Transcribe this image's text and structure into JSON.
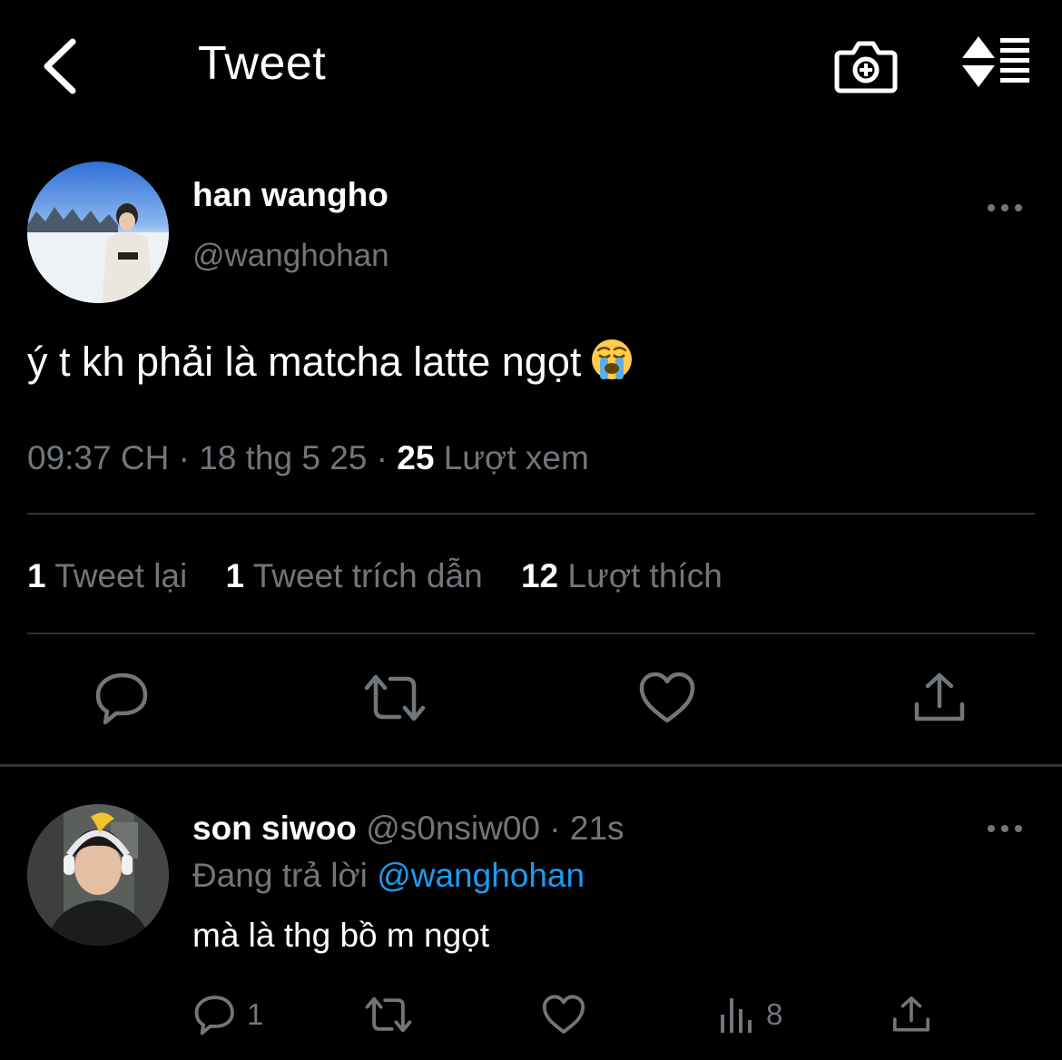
{
  "header": {
    "title": "Tweet"
  },
  "tweet": {
    "author_name": "han wangho",
    "author_handle": "@wanghohan",
    "text": "ý t kh phải là matcha latte ngọt",
    "time": "09:37 CH",
    "date": "18 thg 5 25",
    "views_count": "25",
    "views_label": "Lượt xem",
    "retweets_count": "1",
    "retweets_label": "Tweet lại",
    "quotes_count": "1",
    "quotes_label": "Tweet trích dẫn",
    "likes_count": "12",
    "likes_label": "Lượt thích"
  },
  "reply": {
    "author_name": "son siwoo",
    "author_handle": "@s0nsiw00",
    "time": "21s",
    "replying_prefix": "Đang trả lời",
    "replying_to": "@wanghohan",
    "text": "mà là thg bồ m ngọt",
    "reply_count": "1",
    "views_count": "8"
  },
  "colors": {
    "background": "#000000",
    "text_primary": "#ffffff",
    "text_secondary": "#71767b",
    "link": "#1d9bf0",
    "divider": "#2f3336"
  }
}
